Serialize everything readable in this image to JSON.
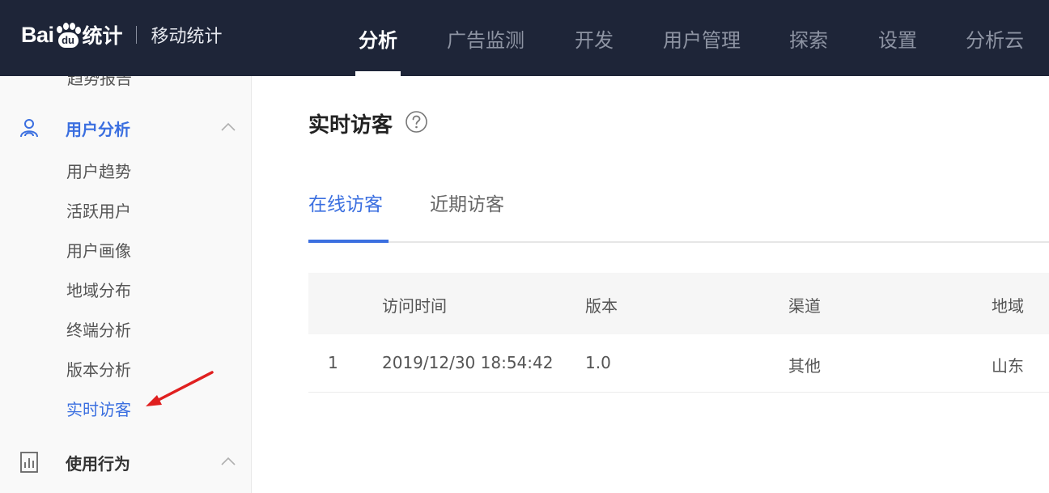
{
  "header": {
    "logo": {
      "brand": "Bai",
      "brand_du": "du",
      "brand_suffix": "统计",
      "product": "移动统计"
    },
    "nav": [
      {
        "label": "分析",
        "active": true
      },
      {
        "label": "广告监测"
      },
      {
        "label": "开发"
      },
      {
        "label": "用户管理"
      },
      {
        "label": "探索"
      },
      {
        "label": "设置"
      },
      {
        "label": "分析云"
      }
    ]
  },
  "sidebar": {
    "cut_item": "趋势报告",
    "groups": [
      {
        "label": "用户分析",
        "icon": "user-icon",
        "expanded": true,
        "active": true,
        "items": [
          {
            "label": "用户趋势"
          },
          {
            "label": "活跃用户"
          },
          {
            "label": "用户画像"
          },
          {
            "label": "地域分布"
          },
          {
            "label": "终端分析"
          },
          {
            "label": "版本分析"
          },
          {
            "label": "实时访客",
            "active": true
          }
        ]
      },
      {
        "label": "使用行为",
        "icon": "bar-chart-icon",
        "expanded": true
      }
    ]
  },
  "main": {
    "title": "实时访客",
    "tabs": [
      {
        "label": "在线访客",
        "active": true
      },
      {
        "label": "近期访客"
      }
    ],
    "table": {
      "columns": [
        "",
        "访问时间",
        "版本",
        "渠道",
        "地域"
      ],
      "rows": [
        [
          "1",
          "2019/12/30 18:54:42",
          "1.0",
          "其他",
          "山东"
        ]
      ]
    }
  },
  "colors": {
    "topbar": "#1e2538",
    "accent": "#3b6fe0",
    "annotation_arrow": "#e02020"
  }
}
